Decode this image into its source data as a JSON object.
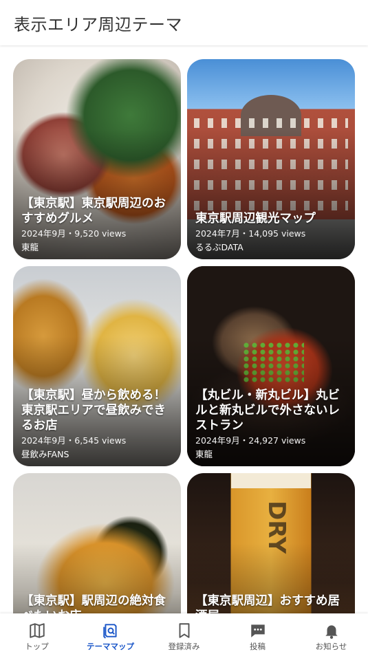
{
  "header": {
    "title": "表示エリア周辺テーマ"
  },
  "cards": [
    {
      "title": "【東京駅】東京駅周辺のおすすめグルメ",
      "meta": "2024年9月・9,520 views",
      "author": "東龍"
    },
    {
      "title": "東京駅周辺観光マップ",
      "meta": "2024年7月・14,095 views",
      "author": "るるぶDATA"
    },
    {
      "title": "【東京駅】昼から飲める！ 東京駅エリアで昼飲みできるお店",
      "meta": "2024年9月・6,545 views",
      "author": "昼飲みFANS"
    },
    {
      "title": "【丸ビル・新丸ビル】丸ビルと新丸ビルで外さないレストラン",
      "meta": "2024年9月・24,927 views",
      "author": "東龍"
    },
    {
      "title": "【東京駅】駅周辺の絶対食べたいお店"
    },
    {
      "title": "【東京駅周辺】おすすめ居酒屋"
    }
  ],
  "nav": {
    "items": [
      {
        "label": "トップ",
        "icon": "map-book-icon"
      },
      {
        "label": "テーママップ",
        "icon": "theme-map-icon",
        "active": true
      },
      {
        "label": "登録済み",
        "icon": "bookmark-icon"
      },
      {
        "label": "投稿",
        "icon": "chat-post-icon"
      },
      {
        "label": "お知らせ",
        "icon": "bell-icon"
      }
    ],
    "active_color": "#1a56c8",
    "inactive_color": "#555555"
  }
}
